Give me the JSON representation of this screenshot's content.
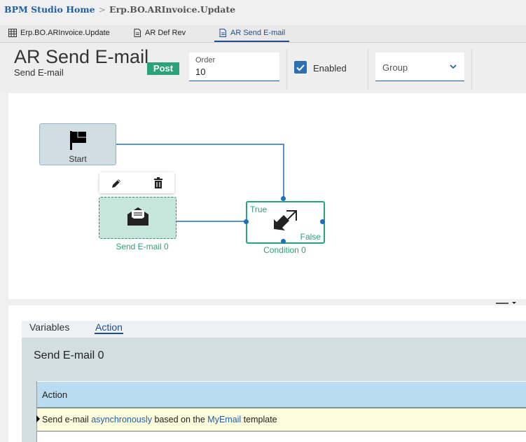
{
  "breadcrumb": {
    "home": "BPM Studio Home",
    "separator": ">",
    "current": "Erp.BO.ARInvoice.Update"
  },
  "doc_tabs": [
    {
      "label": "Erp.BO.ARInvoice.Update",
      "icon": "table-icon"
    },
    {
      "label": "AR Def Rev",
      "icon": "document-icon"
    },
    {
      "label": "AR Send E-mail",
      "icon": "document-icon",
      "active": true
    }
  ],
  "header": {
    "title": "AR Send E-mail",
    "subtitle": "Send E-mail",
    "badge": "Post",
    "order_label": "Order",
    "order_value": "10",
    "enabled_label": "Enabled",
    "enabled_checked": true,
    "group_placeholder": "Group"
  },
  "workflow": {
    "start_label": "Start",
    "email_label": "Send E-mail 0",
    "condition_label": "Condition 0",
    "condition_true": "True",
    "condition_false": "False"
  },
  "panel": {
    "tabs": [
      "Variables",
      "Action"
    ],
    "active_tab": "Action",
    "section_title": "Send E-mail 0",
    "grid_header": "Action",
    "row": {
      "prefix": "Send e-mail ",
      "link1": "asynchronously",
      "middle": " based on the ",
      "link2": "MyEmail",
      "suffix": " template"
    }
  },
  "colors": {
    "accent": "#1f5fa8",
    "node_green": "#2aa37a",
    "connector": "#1f6fbf"
  }
}
